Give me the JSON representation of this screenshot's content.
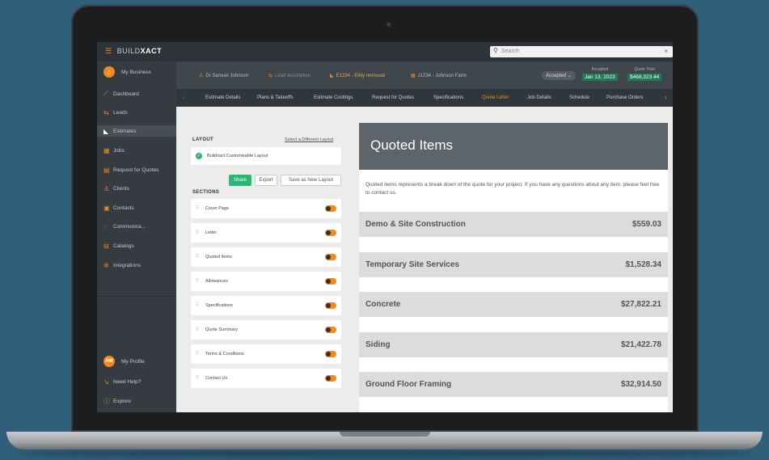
{
  "colors": {
    "accent": "#f28a1b",
    "success": "#2bb673",
    "background": "#2f5f7a"
  },
  "topbar": {
    "brand_prefix": "BUILD",
    "brand_suffix": "XACT",
    "search_placeholder": "Search"
  },
  "sidebar": {
    "business": "My Business",
    "items": [
      {
        "label": "Dashboard",
        "icon": "chart-icon"
      },
      {
        "label": "Leads",
        "icon": "leads-icon"
      },
      {
        "label": "Estimates",
        "icon": "estimates-icon"
      },
      {
        "label": "Jobs",
        "icon": "jobs-icon"
      },
      {
        "label": "Request for Quotes",
        "icon": "rfq-icon"
      },
      {
        "label": "Clients",
        "icon": "clients-icon"
      },
      {
        "label": "Contacts",
        "icon": "contacts-icon"
      },
      {
        "label": "Communica...",
        "icon": "chat-icon"
      },
      {
        "label": "Catalogs",
        "icon": "catalog-icon"
      },
      {
        "label": "Integrations",
        "icon": "integrations-icon"
      }
    ],
    "profile_initials": "AW",
    "profile": "My Profile",
    "help": "Need Help?",
    "explore": "Explore"
  },
  "job_header": {
    "person": "Dr Samuel Johnson",
    "lead": "Lead description",
    "estimate": "E1234 - Elkly rennovat",
    "job": "J1234 - Johnson Farm",
    "status": "Accepted",
    "accepted_label": "Accepted",
    "accepted_date": "Jan 13, 2023",
    "total_label": "Quote Total",
    "total_value": "$468,323.44"
  },
  "tabs": [
    "Estimate Details",
    "Plans & Takeoffs",
    "Estimate Costings",
    "Request for Quotes",
    "Specifications",
    "Quote Letter",
    "Job Details",
    "Schedule",
    "Purchase Orders"
  ],
  "active_tab": "Quote Letter",
  "layout": {
    "label": "LAYOUT",
    "change_link": "Select a Different Layout",
    "selected": "Buildxact Customisable Layout",
    "share": "Share",
    "export": "Export",
    "save": "Save as New Layout",
    "sections_label": "SECTIONS",
    "sections": [
      "Cover Page",
      "Letter",
      "Quoted Items",
      "Allowances",
      "Specifications",
      "Quote Summary",
      "Terms & Conditions",
      "Contact Us"
    ]
  },
  "preview": {
    "title": "Quoted Items",
    "intro": "Quoted items represents a break down of the quote for your project. If you have any questions about any item, please feel free to contact us.",
    "items": [
      {
        "name": "Demo & Site Construction",
        "price": "$559.03"
      },
      {
        "name": "Temporary Site Services",
        "price": "$1,528.34"
      },
      {
        "name": "Concrete",
        "price": "$27,822.21"
      },
      {
        "name": "Siding",
        "price": "$21,422.78"
      },
      {
        "name": "Ground Floor Framing",
        "price": "$32,914.50"
      }
    ]
  }
}
